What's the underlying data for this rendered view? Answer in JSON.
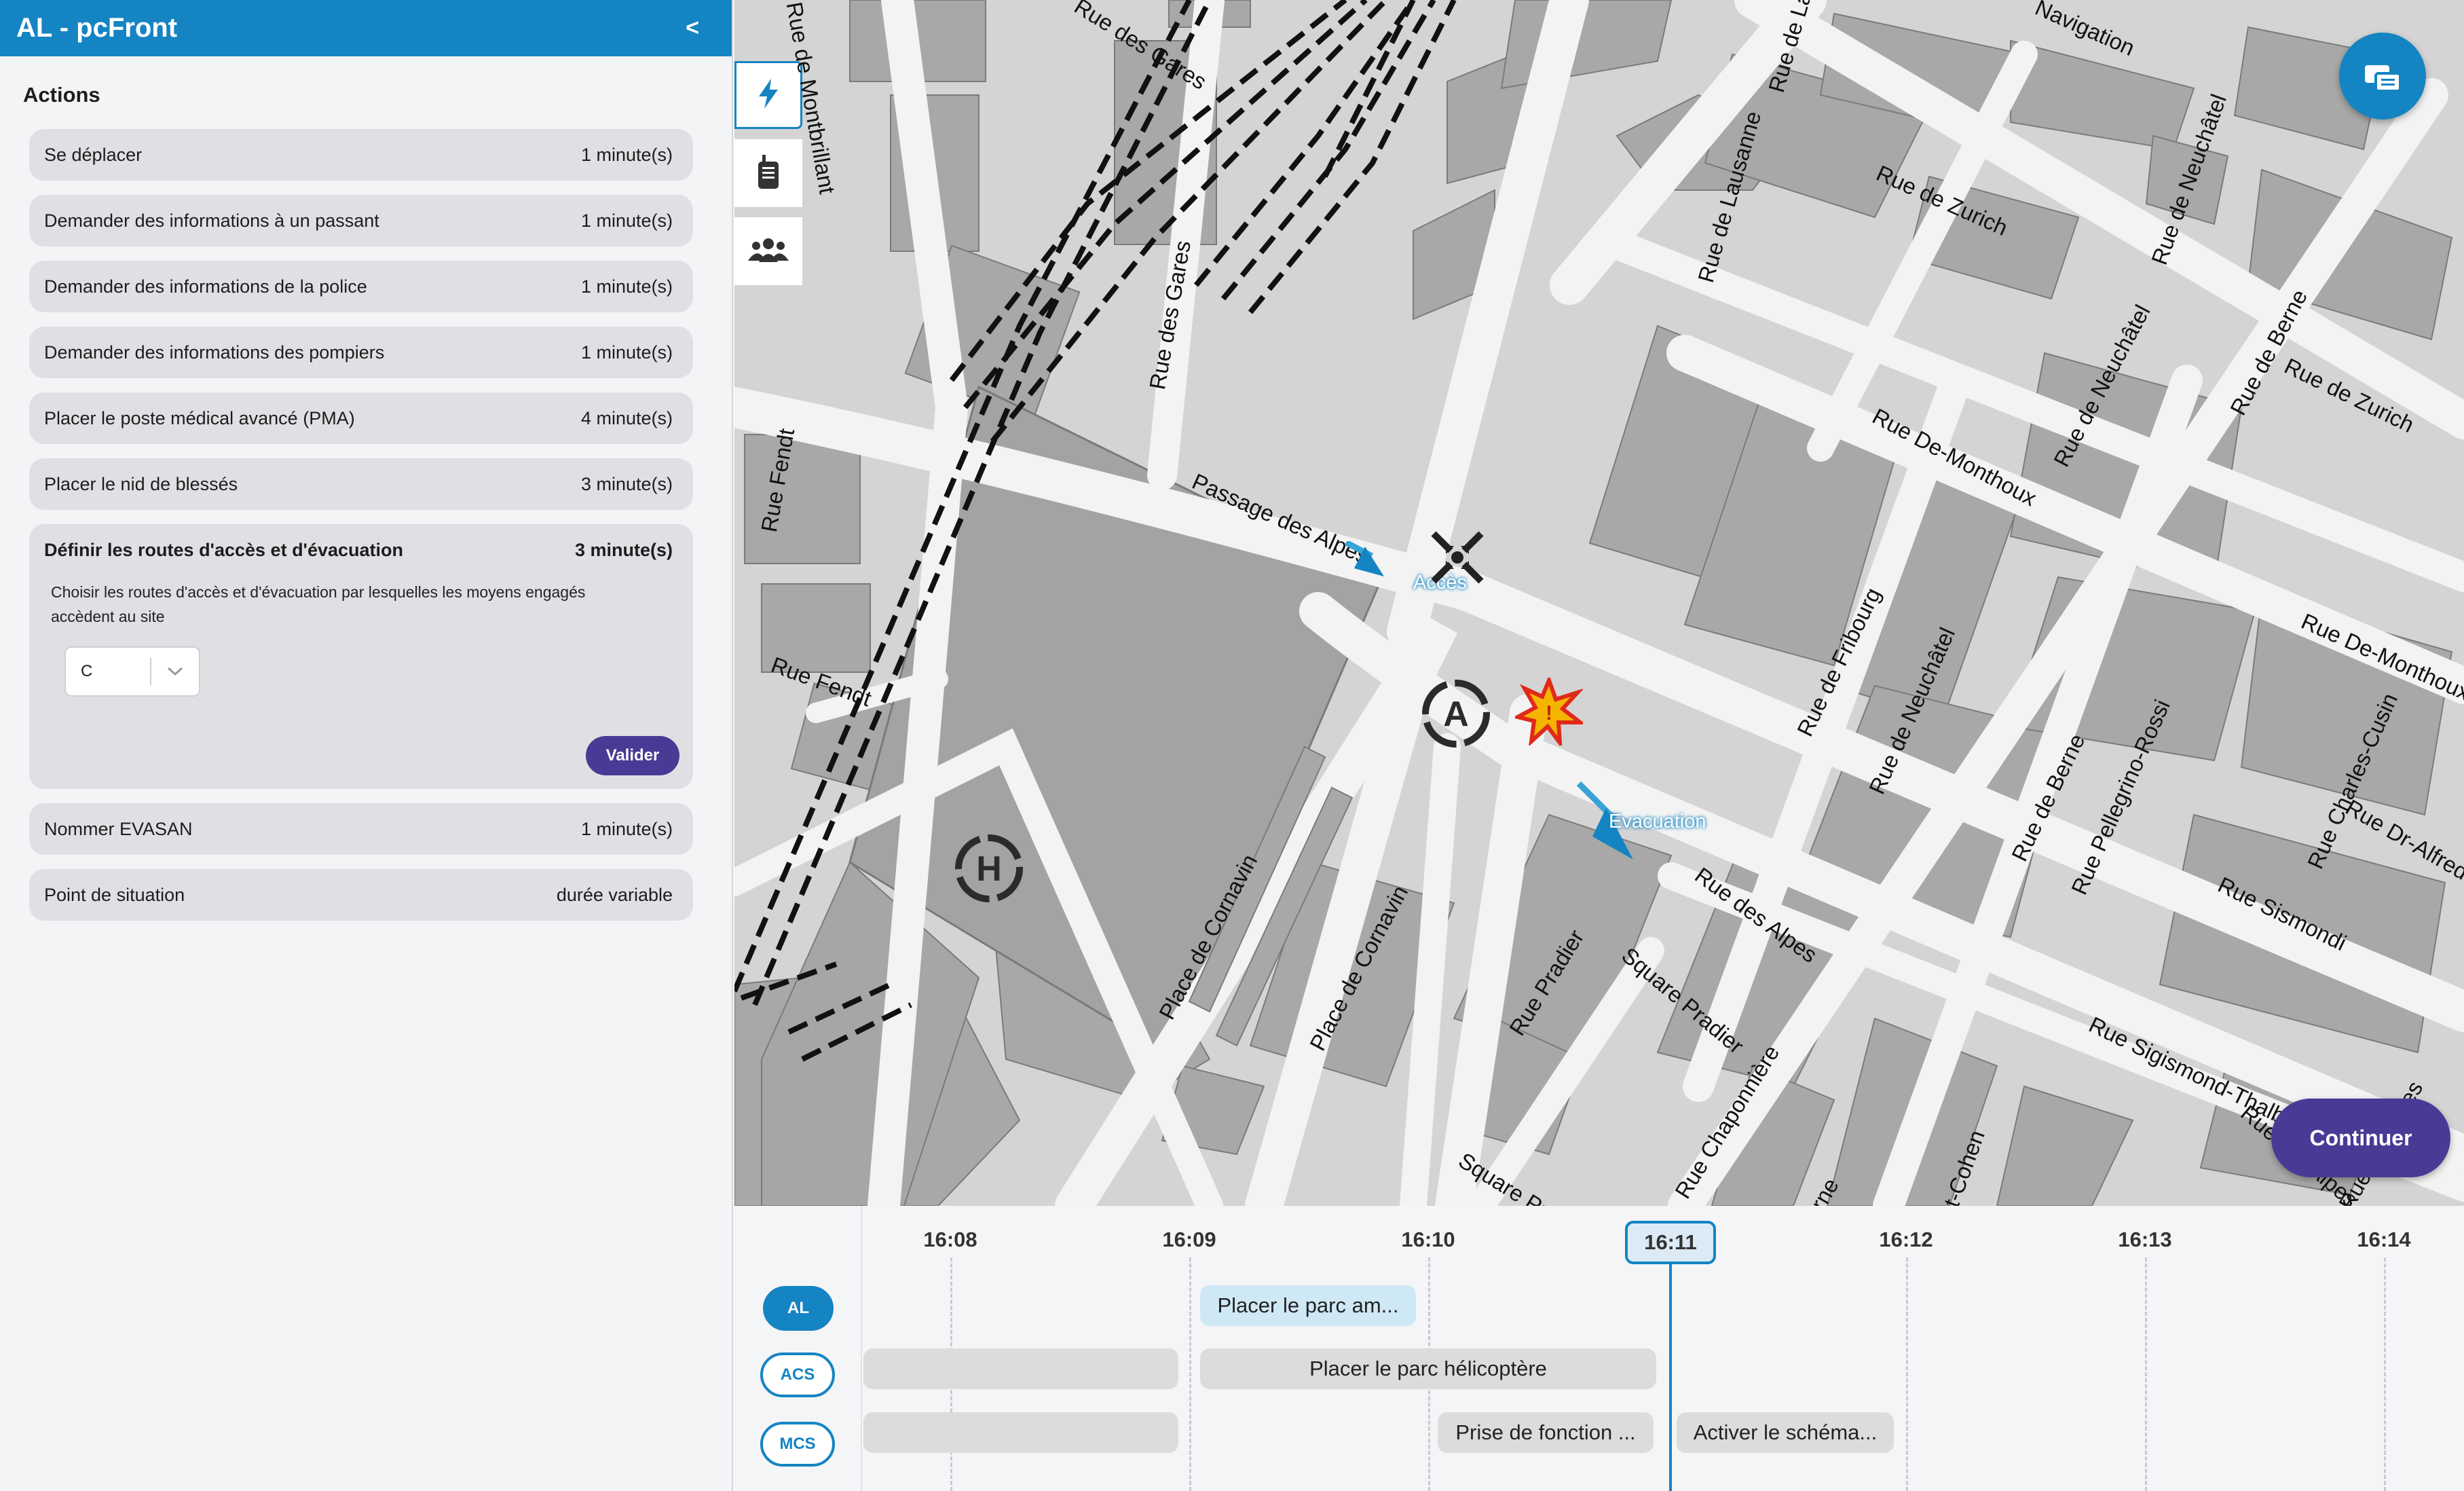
{
  "app": {
    "title": "AL - pcFront",
    "collapse_label": "<"
  },
  "actions": {
    "heading": "Actions",
    "items": [
      {
        "label": "Se déplacer",
        "duration": "1  minute(s)"
      },
      {
        "label": "Demander des informations à un passant",
        "duration": "1  minute(s)"
      },
      {
        "label": "Demander des informations de la police",
        "duration": "1  minute(s)"
      },
      {
        "label": "Demander des informations des pompiers",
        "duration": "1  minute(s)"
      },
      {
        "label": "Placer le poste médical avancé (PMA)",
        "duration": "4  minute(s)"
      },
      {
        "label": "Placer le nid de blessés",
        "duration": "3  minute(s)"
      }
    ],
    "expanded": {
      "label": "Définir les routes d'accès et d'évacuation",
      "duration": "3  minute(s)",
      "description": "Choisir les routes d'accès et d'évacuation par lesquelles les moyens engagés accèdent au site",
      "select_value": "C",
      "submit_label": "Valider"
    },
    "items_after": [
      {
        "label": "Nommer EVASAN",
        "duration": "1  minute(s)"
      },
      {
        "label": "Point de situation",
        "duration": "durée variable"
      }
    ]
  },
  "map": {
    "streets": [
      "Rue des Gares",
      "Rue de Montbrillant",
      "Rue des Gares",
      "Rue Fendt",
      "Rue Fendt",
      "Passage des Alpes",
      "Place de Cornavin",
      "Place de Cornavin",
      "Rue de Lausanne",
      "Rue de La",
      "Navigation",
      "Rue de Zurich",
      "Rue de Neuchâtel",
      "Rue de Neuchâtel",
      "Rue De-Monthoux",
      "Rue de Berne",
      "Rue de Zurich",
      "Rue De-Monthoux",
      "Rue de Fribourg",
      "Rue de Neuchâtel",
      "Rue de Berne",
      "Rue Pellegrino-Rossi",
      "Rue Charles-Cusin",
      "Rue Dr-Alfred",
      "Rue Sismondi",
      "Rue Sigismond-Thalberg",
      "Rue des Alpes",
      "Rue Pradier",
      "Square Pradier",
      "Rue Chaponnière",
      "Square Pr",
      "Rue des Alpes",
      "Rue des Alpes",
      "rne",
      "t-Cohen"
    ],
    "marker_access": "Accès",
    "marker_evacuation": "Evacuation",
    "continue_label": "Continuer",
    "tools": [
      "lightning-icon",
      "radio-icon",
      "group-icon"
    ]
  },
  "timeline": {
    "times": [
      "16:08",
      "16:09",
      "16:10",
      "16:11",
      "16:12",
      "16:13",
      "16:14"
    ],
    "current_time": "16:11",
    "actors": [
      "AL",
      "ACS",
      "MCS"
    ],
    "bars": {
      "al_1": "Placer le parc am...",
      "acs_1": "",
      "acs_2": "Placer le parc hélicoptère",
      "mcs_1": "",
      "mcs_2": "Prise de fonction ...",
      "mcs_3": "Activer le schéma..."
    }
  }
}
